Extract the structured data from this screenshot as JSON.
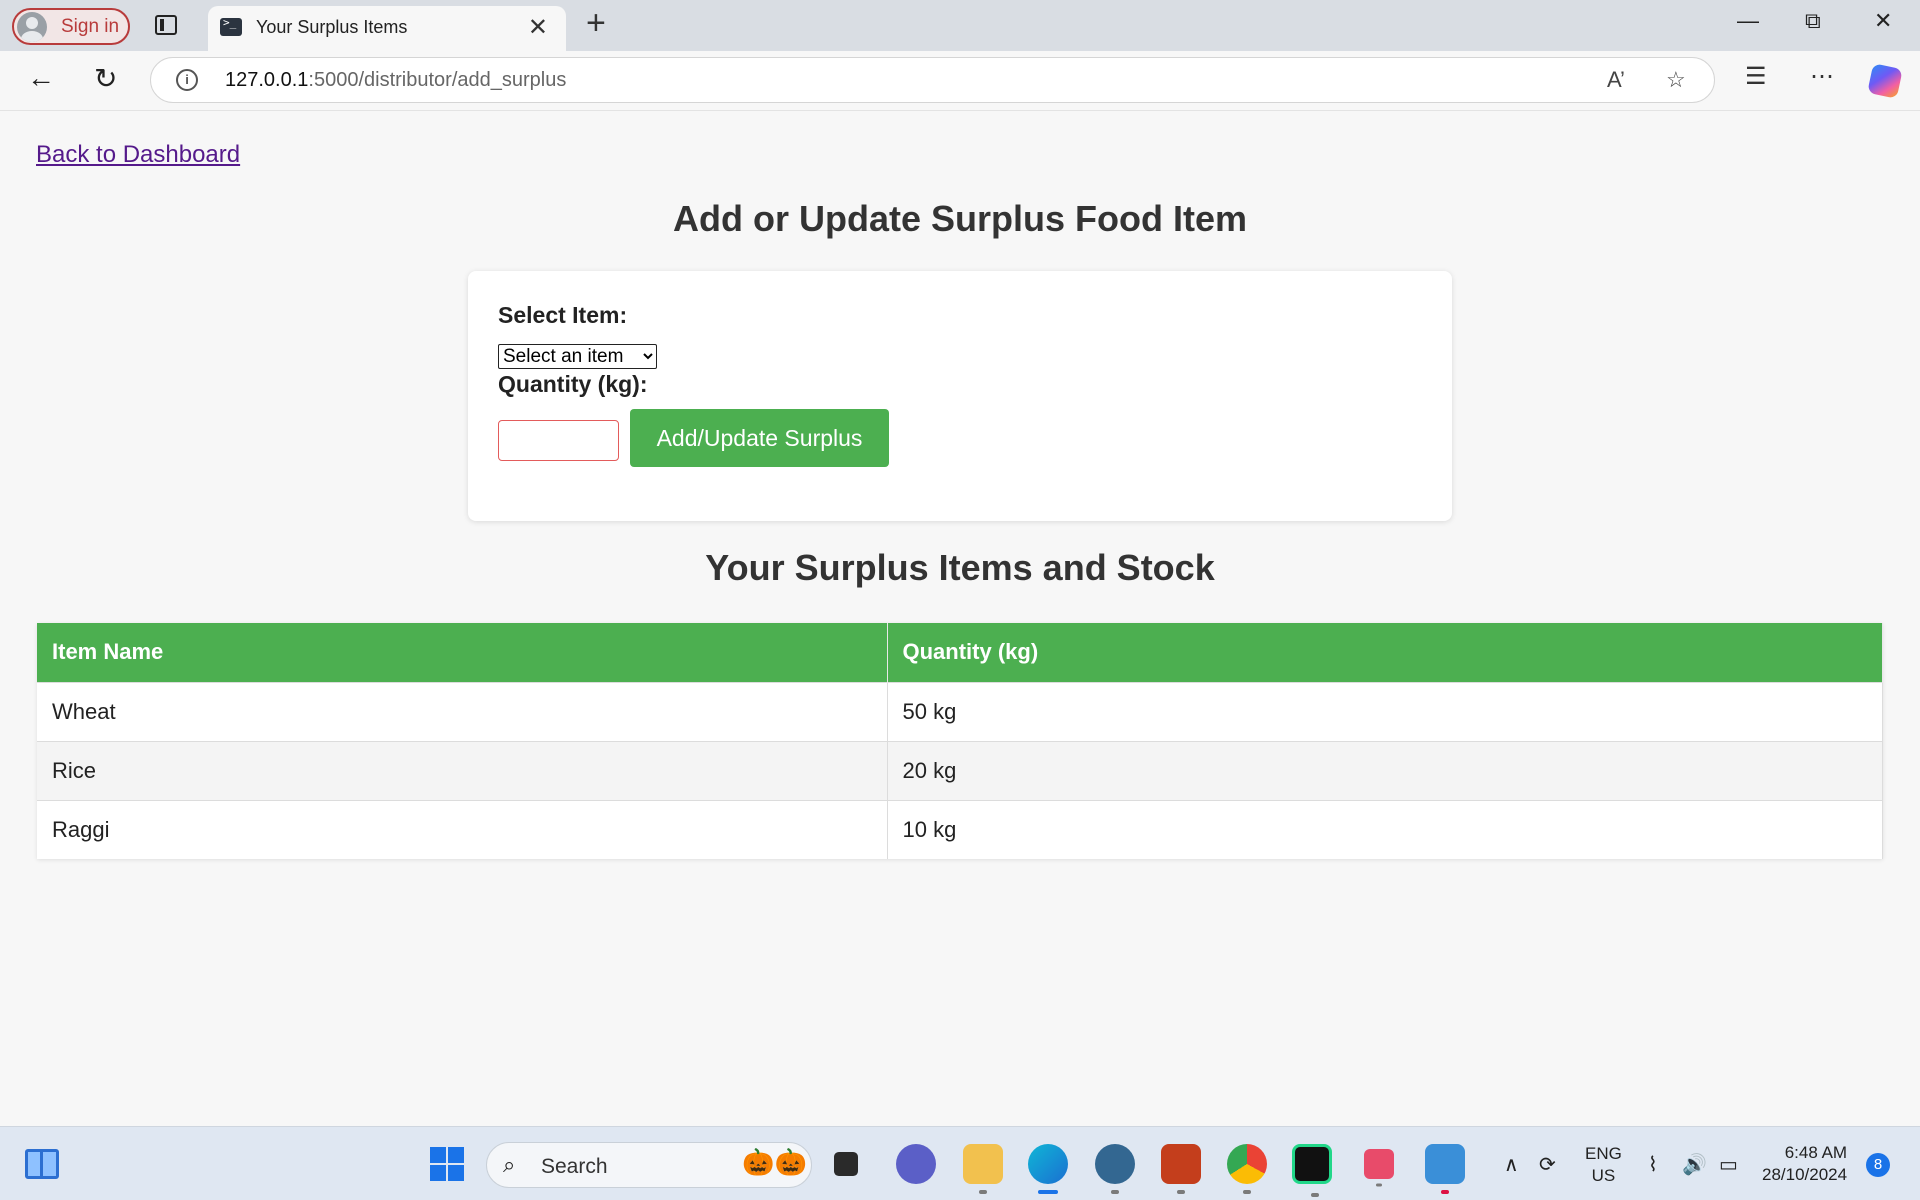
{
  "browser": {
    "signin_label": "Sign in",
    "tab_title": "Your Surplus Items",
    "tab_close": "✕",
    "new_tab": "+",
    "url_host": "127.0.0.1",
    "url_path": ":5000/distributor/add_surplus"
  },
  "page": {
    "back_link": "Back to Dashboard",
    "form_heading": "Add or Update Surplus Food Item",
    "select_label": "Select Item:",
    "select_selected": "Select an item",
    "quantity_label": "Quantity (kg):",
    "quantity_value": "",
    "submit_label": "Add/Update Surplus",
    "table_heading": "Your Surplus Items and Stock",
    "table": {
      "headers": [
        "Item Name",
        "Quantity (kg)"
      ],
      "rows": [
        [
          "Wheat",
          "50 kg"
        ],
        [
          "Rice",
          "20 kg"
        ],
        [
          "Raggi",
          "10 kg"
        ]
      ]
    }
  },
  "taskbar": {
    "search_placeholder": "Search",
    "lang_line1": "ENG",
    "lang_line2": "US",
    "time": "6:48 AM",
    "date": "28/10/2024",
    "notification_count": "8"
  },
  "colors": {
    "accent_green": "#4caf50",
    "link_visited": "#551a8b",
    "input_invalid_border": "#e35b5b"
  }
}
